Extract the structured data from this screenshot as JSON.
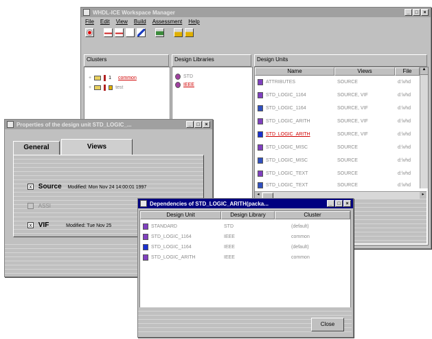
{
  "workspace": {
    "title": "WHDL-ICE Workspace Manager",
    "menu": [
      "File",
      "Edit",
      "View",
      "Build",
      "Assessment",
      "Help"
    ],
    "clusters_header": "Clusters",
    "clusters": [
      {
        "expander": "+",
        "number": "1",
        "name": "common"
      },
      {
        "expander": "+",
        "number": "",
        "name": "test"
      }
    ],
    "libraries_header": "Design Libraries",
    "libraries": [
      "STD",
      "IEEE"
    ],
    "units_header": "Design Units",
    "columns": [
      "Name",
      "Views",
      "File"
    ],
    "units": [
      {
        "name": "ATTRIBUTES",
        "views": "SOURCE",
        "file": "d:\\vhd"
      },
      {
        "name": "STD_LOGIC_1164",
        "views": "SOURCE, VIF",
        "file": "d:\\vhd"
      },
      {
        "name": "STD_LOGIC_1164",
        "views": "SOURCE, VIF",
        "file": "d:\\vhd"
      },
      {
        "name": "STD_LOGIC_ARITH",
        "views": "SOURCE, VIF",
        "file": "d:\\vhd"
      },
      {
        "name": "STD_LOGIC_ARITH",
        "views": "SOURCE, VIF",
        "file": "d:\\vhd"
      },
      {
        "name": "STD_LOGIC_MISC",
        "views": "SOURCE",
        "file": "d:\\vhd"
      },
      {
        "name": "STD_LOGIC_MISC",
        "views": "SOURCE",
        "file": "d:\\vhd"
      },
      {
        "name": "STD_LOGIC_TEXT",
        "views": "SOURCE",
        "file": "d:\\vhd"
      },
      {
        "name": "STD_LOGIC_TEXT",
        "views": "SOURCE",
        "file": "d:\\vhd"
      }
    ]
  },
  "properties": {
    "title": "Properties of the design unit STD_LOGIC_...",
    "tabs": [
      "General",
      "Views"
    ],
    "views": [
      {
        "label": "Source",
        "checked": "x",
        "detail": "Modified: Mon Nov 24 14:00:01 1997"
      },
      {
        "label": "ASSI",
        "checked": "",
        "detail": ""
      },
      {
        "label": "VIF",
        "checked": "x",
        "detail": "Modified: Tue Nov 25"
      }
    ]
  },
  "dependencies": {
    "title": "Dependencies of STD_LOGIC_ARITH(packa...",
    "columns": [
      "Design Unit",
      "Design Library",
      "Cluster"
    ],
    "rows": [
      {
        "unit": "STANDARD",
        "library": "STD",
        "cluster": "(default)"
      },
      {
        "unit": "STD_LOGIC_1164",
        "library": "IEEE",
        "cluster": "common"
      },
      {
        "unit": "STD_LOGIC_1164",
        "library": "IEEE",
        "cluster": "(default)"
      },
      {
        "unit": "STD_LOGIC_ARITH",
        "library": "IEEE",
        "cluster": "common"
      }
    ],
    "close_label": "Close"
  },
  "colors": {
    "active_title": "#000080",
    "highlight": "#d00000",
    "window_bg": "#c0c0c0"
  }
}
